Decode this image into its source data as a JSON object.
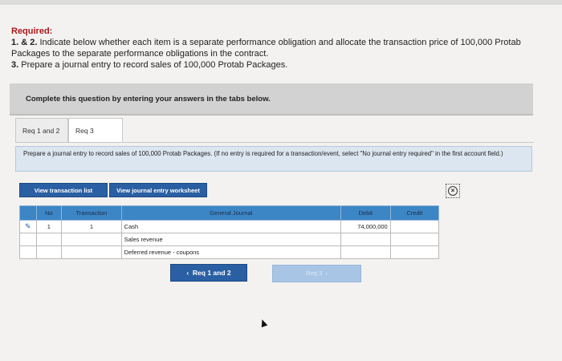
{
  "required": {
    "title": "Required:",
    "item1_num": "1. & 2.",
    "item1_text": " Indicate below whether each item is a separate performance obligation and allocate the transaction price of 100,000 Protab Packages to the separate performance obligations in the contract.",
    "item3_num": "3.",
    "item3_text": " Prepare a journal entry to record sales of 100,000 Protab Packages."
  },
  "banner": "Complete this question by entering your answers in the tabs below.",
  "tabs": [
    {
      "label": "Req 1 and 2"
    },
    {
      "label": "Req 3"
    }
  ],
  "instructions": {
    "main": "Prepare a journal entry to record sales of 100,000 Protab Packages.",
    "note": " (If no entry is required for a transaction/event, select \"No journal entry required\" in the first account field.)"
  },
  "buttons": {
    "view_list": "View transaction list",
    "view_worksheet": "View journal entry worksheet"
  },
  "journal": {
    "headers": {
      "no": "No",
      "transaction": "Transaction",
      "general_journal": "General Journal",
      "debit": "Debit",
      "credit": "Credit"
    },
    "rows": [
      {
        "no": "1",
        "transaction": "1",
        "account": "Cash",
        "debit": "74,000,000",
        "credit": ""
      },
      {
        "no": "",
        "transaction": "",
        "account": "Sales revenue",
        "debit": "",
        "credit": ""
      },
      {
        "no": "",
        "transaction": "",
        "account": "Deferred revenue - coupons",
        "debit": "",
        "credit": ""
      }
    ]
  },
  "nav": {
    "prev_label": "Req 1 and 2",
    "prev_icon": "chevron-left-icon",
    "next_label": "Req 3",
    "next_icon": "chevron-right-icon"
  },
  "colors": {
    "header_blue": "#3d86c6",
    "button_blue": "#2a5fa3",
    "required_red": "#b0161d"
  }
}
